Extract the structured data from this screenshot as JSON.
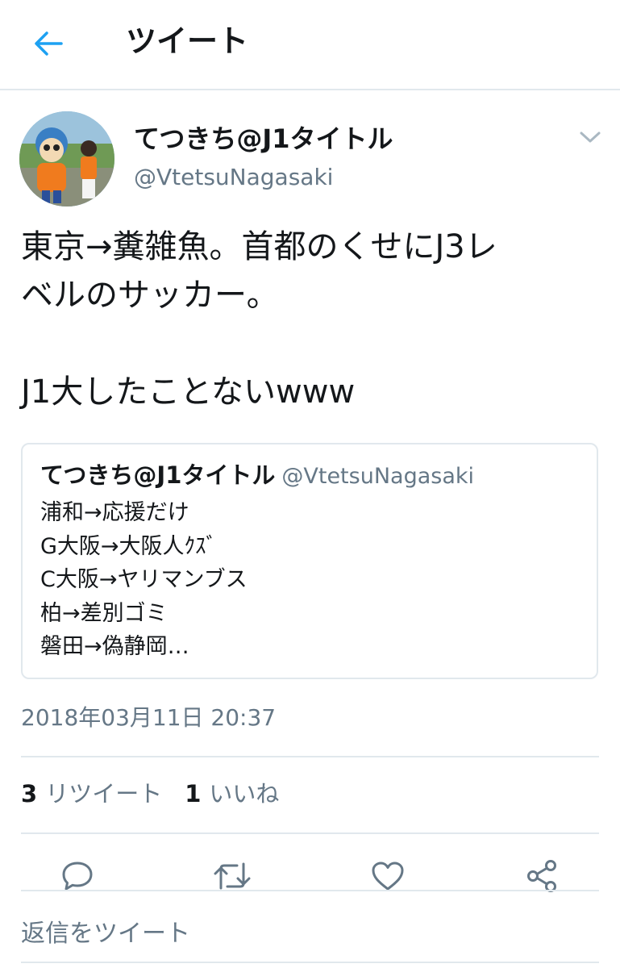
{
  "header": {
    "title": "ツイート",
    "back_icon": "arrow-left-icon"
  },
  "tweet": {
    "display_name": "てつきち@J1タイトル",
    "handle": "@VtetsuNagasaki",
    "text_lines": [
      "東京→糞雑魚。首都のくせにJ3レ",
      "ベルのサッカー。",
      "J1大したことないwww"
    ],
    "quoted": {
      "display_name": "てつきち@J1タイトル",
      "handle": "@VtetsuNagasaki",
      "lines": [
        "浦和→応援だけ",
        "G大阪→大阪人ｸｽﾞ",
        "C大阪→ヤリマンブス",
        "柏→差別ゴミ",
        "磐田→偽静岡…"
      ]
    },
    "timestamp": "2018年03月11日 20:37",
    "stats": {
      "retweets_count": "3",
      "retweets_label": "リツイート",
      "likes_count": "1",
      "likes_label": "いいね"
    }
  },
  "reply": {
    "placeholder": "返信をツイート"
  },
  "colors": {
    "accent": "#1da1f2",
    "text": "#14171a",
    "secondary": "#657786",
    "divider": "#e1e8ed"
  }
}
